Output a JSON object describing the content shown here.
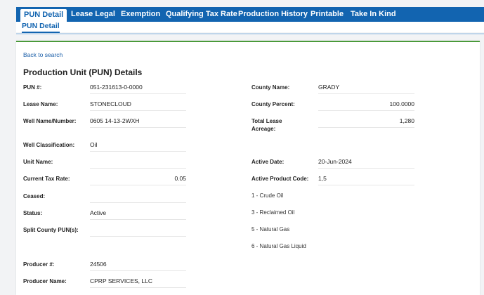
{
  "tabs": [
    "PUN Detail",
    "Lease Legal",
    "Exemption",
    "Qualifying Tax Rate",
    "Production History",
    "Printable",
    "Take In Kind"
  ],
  "subtab": "PUN Detail",
  "back_link": "Back to search",
  "heading": "Production Unit (PUN) Details",
  "left_fields": [
    {
      "label": "PUN #:",
      "value": "051-231613-0-0000"
    },
    {
      "label": "Lease Name:",
      "value": "STONECLOUD"
    },
    {
      "label": "Well Name/Number:",
      "value": "0605 14-13-2WXH"
    },
    {
      "label": "Well Classification:",
      "value": "Oil"
    },
    {
      "label": "Unit Name:",
      "value": ""
    },
    {
      "label": "Current Tax Rate:",
      "value": "0.05"
    },
    {
      "label": "Ceased:",
      "value": ""
    },
    {
      "label": "Status:",
      "value": "Active"
    },
    {
      "label": "Split County PUN(s):",
      "value": ""
    },
    {
      "label": "Producer #:",
      "value": "24506"
    },
    {
      "label": "Producer Name:",
      "value": "CPRP SERVICES, LLC"
    }
  ],
  "right_fields": [
    {
      "label": "County Name:",
      "value": "GRADY"
    },
    {
      "label": "County Percent:",
      "value": "100.0000"
    },
    {
      "label": "Total Lease Acreage:",
      "value": "1,280"
    },
    {
      "label": "Active Date:",
      "value": "20-Jun-2024"
    },
    {
      "label": "Active Product Code:",
      "value": "1,5"
    }
  ],
  "product_codes": [
    "1 - Crude Oil",
    "3 - Reclaimed Oil",
    "5 - Natural Gas",
    "6 - Natural Gas Liquid"
  ]
}
